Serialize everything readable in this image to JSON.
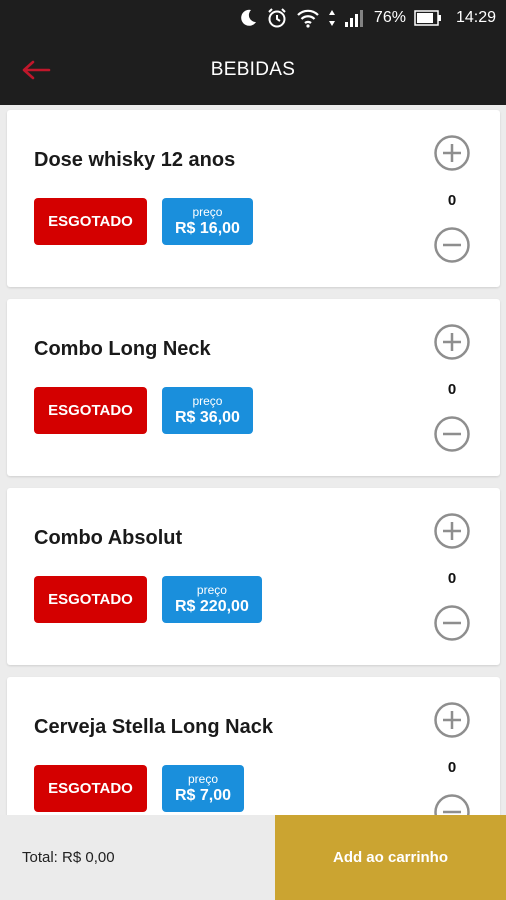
{
  "status_bar": {
    "battery": "76%",
    "time": "14:29"
  },
  "app_bar": {
    "title": "BEBIDAS"
  },
  "products": [
    {
      "name": "Dose whisky 12 anos",
      "status": "ESGOTADO",
      "price_label": "preço",
      "price": "R$ 16,00",
      "quantity": "0"
    },
    {
      "name": "Combo Long Neck",
      "status": "ESGOTADO",
      "price_label": "preço",
      "price": "R$ 36,00",
      "quantity": "0"
    },
    {
      "name": "Combo Absolut",
      "status": "ESGOTADO",
      "price_label": "preço",
      "price": "R$ 220,00",
      "quantity": "0"
    },
    {
      "name": "Cerveja Stella Long Nack",
      "status": "ESGOTADO",
      "price_label": "preço",
      "price": "R$ 7,00",
      "quantity": "0"
    }
  ],
  "footer": {
    "total": "Total: R$ 0,00",
    "add_to_cart": "Add ao carrinho"
  },
  "colors": {
    "sold_out": "#d40000",
    "price": "#1a8fdc",
    "cart_button": "#cba431",
    "bar": "#1e1e1e",
    "back_arrow": "#c0172b"
  }
}
